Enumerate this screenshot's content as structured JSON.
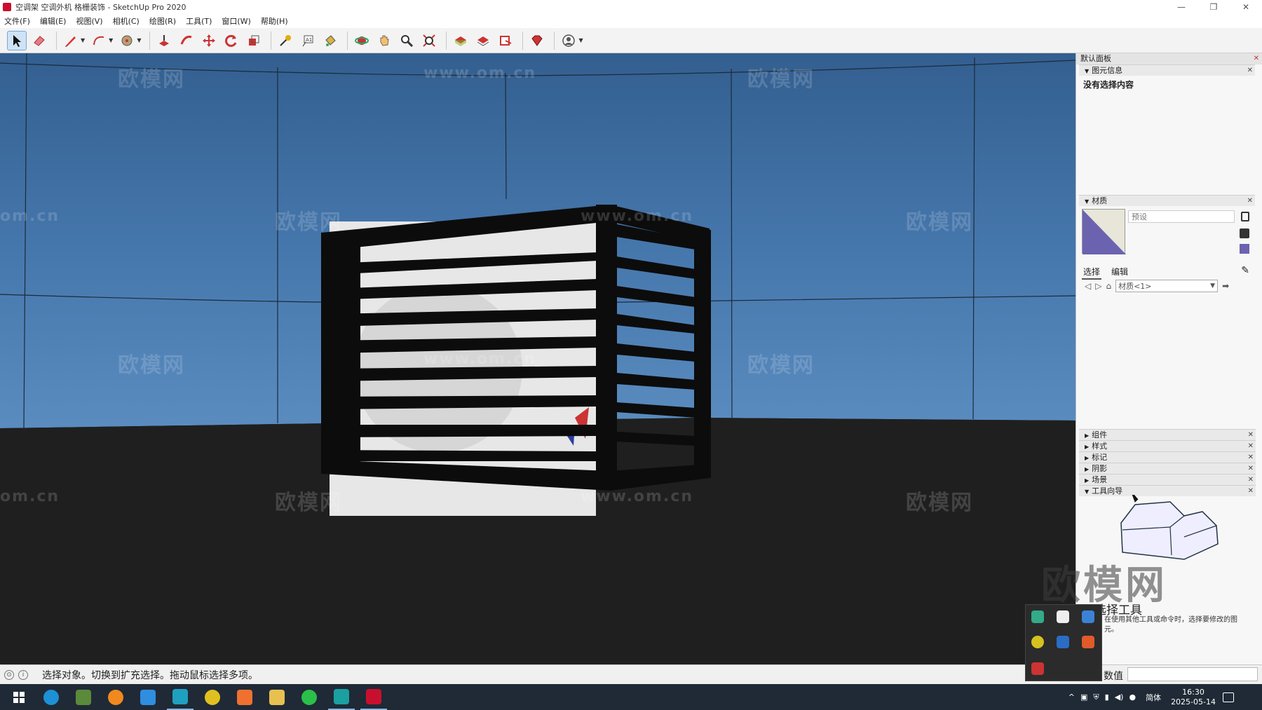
{
  "window": {
    "title": "空调架 空调外机 格栅装饰 - SketchUp Pro 2020",
    "controls": [
      "—",
      "❐",
      "✕"
    ]
  },
  "menu": [
    "文件(F)",
    "编辑(E)",
    "视图(V)",
    "相机(C)",
    "绘图(R)",
    "工具(T)",
    "窗口(W)",
    "帮助(H)"
  ],
  "watermarks": [
    "欧模网",
    "www.om.cn",
    "om.cn"
  ],
  "panel": {
    "title": "默认面板",
    "entity_info": {
      "title": "图元信息",
      "message": "没有选择内容"
    },
    "materials": {
      "title": "材质",
      "name_placeholder": "预设",
      "tab_select": "选择",
      "tab_edit": "编辑",
      "collection": "材质<1>"
    },
    "collapsed_trays": [
      "组件",
      "样式",
      "标记",
      "阴影",
      "场景"
    ],
    "instructor": {
      "title": "工具向导",
      "overlay_text": "欧模网",
      "tool_title": "选择工具",
      "description": "在使用其他工具或命令时，选择要修改的图元。"
    }
  },
  "status": {
    "message": "选择对象。切换到扩充选择。拖动鼠标选择多项。",
    "measurement_label": "数值",
    "measurement_value": ""
  },
  "tray": {
    "ime": "简体",
    "time": "16:30",
    "date": "2025-05-14"
  },
  "colors": {
    "sky": "#3f6fa3",
    "ground": "#1f1f1f",
    "cage": "#0c0c0c",
    "accent": "#c8102e"
  }
}
